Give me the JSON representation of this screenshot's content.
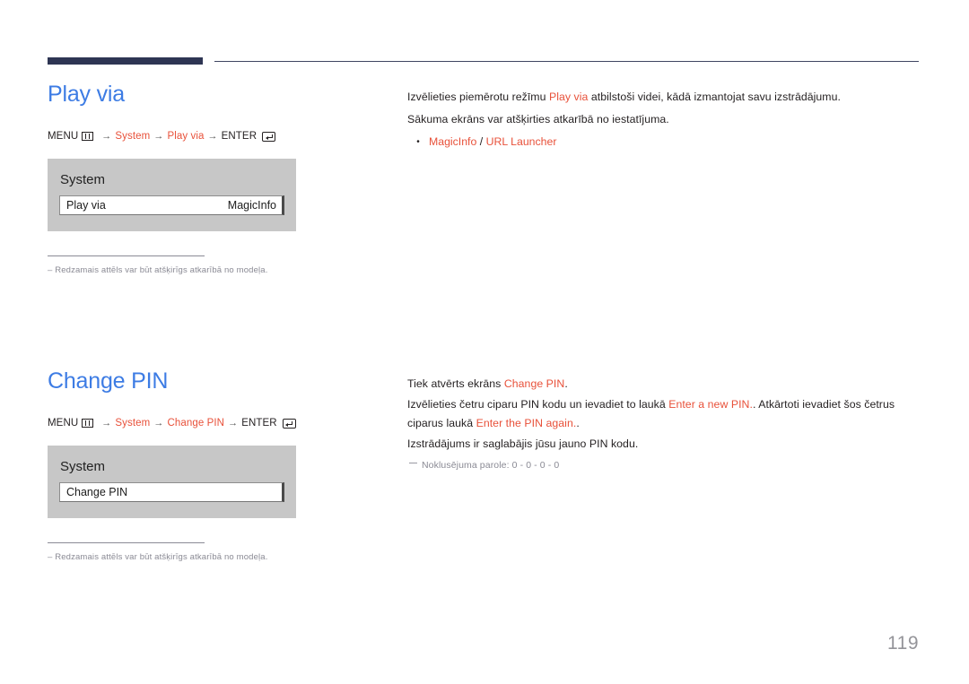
{
  "page": {
    "number": "119",
    "accent_blue": "#3d7ce4",
    "accent_red": "#e8513a",
    "rule_navy": "#2e3553",
    "panel_gray": "#c7c7c7"
  },
  "sections": [
    {
      "heading": "Play via",
      "menu_path": {
        "menu_label": "MENU",
        "menu_icon": "menu-grid-icon",
        "arrow": "→",
        "step1": "System",
        "step2": "Play via",
        "enter_label": "ENTER",
        "enter_icon": "enter-return-icon"
      },
      "osd": {
        "title": "System",
        "row_label": "Play via",
        "row_value": "MagicInfo"
      },
      "footnote": "–  Redzamais attēls var būt atšķirīgs atkarībā no modeļa.",
      "body": {
        "p1_a": "Izvēlieties piemērotu režīmu ",
        "p1_red": "Play via",
        "p1_b": " atbilstoši videi, kādā izmantojat savu izstrādājumu.",
        "p2": "Sākuma ekrāns var atšķirties atkarībā no iestatījuma.",
        "bullet_a": "MagicInfo",
        "bullet_sep": " / ",
        "bullet_b": "URL Launcher",
        "bullet_dot": "•"
      }
    },
    {
      "heading": "Change PIN",
      "menu_path": {
        "menu_label": "MENU",
        "menu_icon": "menu-grid-icon",
        "arrow": "→",
        "step1": "System",
        "step2": "Change PIN",
        "enter_label": "ENTER",
        "enter_icon": "enter-return-icon"
      },
      "osd": {
        "title": "System",
        "row_label": "Change PIN",
        "row_value": ""
      },
      "footnote": "–  Redzamais attēls var būt atšķirīgs atkarībā no modeļa.",
      "body": {
        "p1_a": "Tiek atvērts ekrāns ",
        "p1_red": "Change PIN",
        "p1_b": ".",
        "p2_a": "Izvēlieties četru ciparu PIN kodu un ievadiet to laukā ",
        "p2_red1": "Enter a new PIN.",
        "p2_b": ". Atkārtoti ievadiet šos četrus ciparus laukā ",
        "p2_red2": "Enter the PIN again.",
        "p2_c": ".",
        "p3": "Izstrādājums ir saglabājis jūsu jauno PIN kodu.",
        "note": "Noklusējuma parole: 0 - 0 - 0 - 0"
      }
    }
  ]
}
